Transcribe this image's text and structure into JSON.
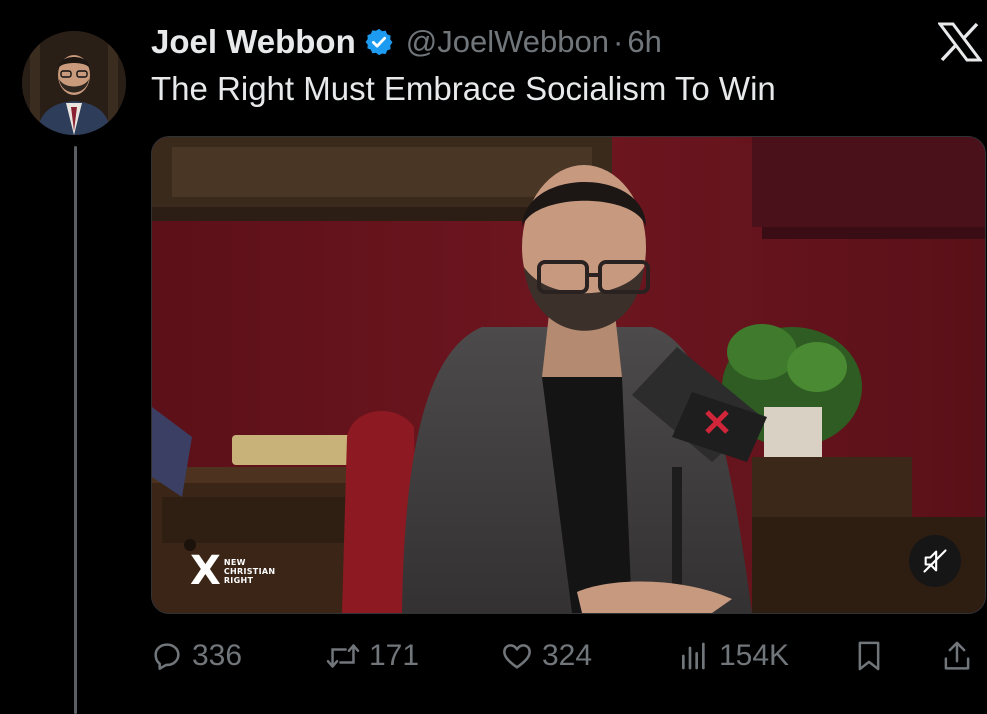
{
  "tweet": {
    "author_name": "Joel Webbon",
    "handle": "@JoelWebbon",
    "separator": "·",
    "time": "6h",
    "text": "The Right Must Embrace Socialism To Win",
    "verified": true,
    "verified_color": "#1d9bf0"
  },
  "media": {
    "type": "video",
    "muted": true,
    "watermark": {
      "mark": "X",
      "lines": [
        "NEW",
        "CHRISTIAN",
        "RIGHT"
      ]
    }
  },
  "actions": {
    "replies": "336",
    "retweets": "171",
    "likes": "324",
    "views": "154K"
  },
  "icons": {
    "reply": "speech-bubble-icon",
    "retweet": "repost-arrows-icon",
    "like": "heart-icon",
    "views": "bar-chart-icon",
    "bookmark": "bookmark-icon",
    "share": "share-upload-icon",
    "mute": "speaker-muted-icon",
    "brand": "x-logo-icon"
  },
  "colors": {
    "background": "#000000",
    "text": "#e7e9ea",
    "secondary": "#71767b"
  }
}
